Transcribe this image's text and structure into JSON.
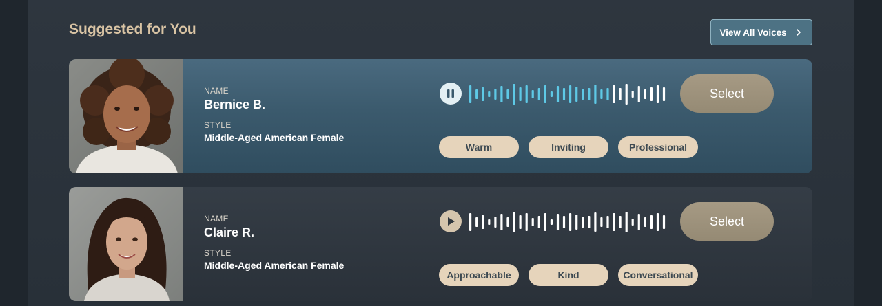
{
  "section": {
    "title": "Suggested for You",
    "view_all_label": "View All Voices"
  },
  "voices": [
    {
      "name_label": "NAME",
      "name": "Bernice B.",
      "style_label": "STYLE",
      "style": "Middle-Aged American Female",
      "playing": true,
      "play_icon": "pause-icon",
      "select_label": "Select",
      "tags": [
        "Warm",
        "Inviting",
        "Professional"
      ]
    },
    {
      "name_label": "NAME",
      "name": "Claire R.",
      "style_label": "STYLE",
      "style": "Middle-Aged American Female",
      "playing": false,
      "play_icon": "play-icon",
      "select_label": "Select",
      "tags": [
        "Approachable",
        "Kind",
        "Conversational"
      ]
    }
  ],
  "colors": {
    "accent_title": "#d9c4a4",
    "waveform_played": "#5ec9e6",
    "waveform_unplayed": "#ffffff",
    "tag_bg": "#e6d4bb",
    "select_bg": "#a69a84"
  }
}
